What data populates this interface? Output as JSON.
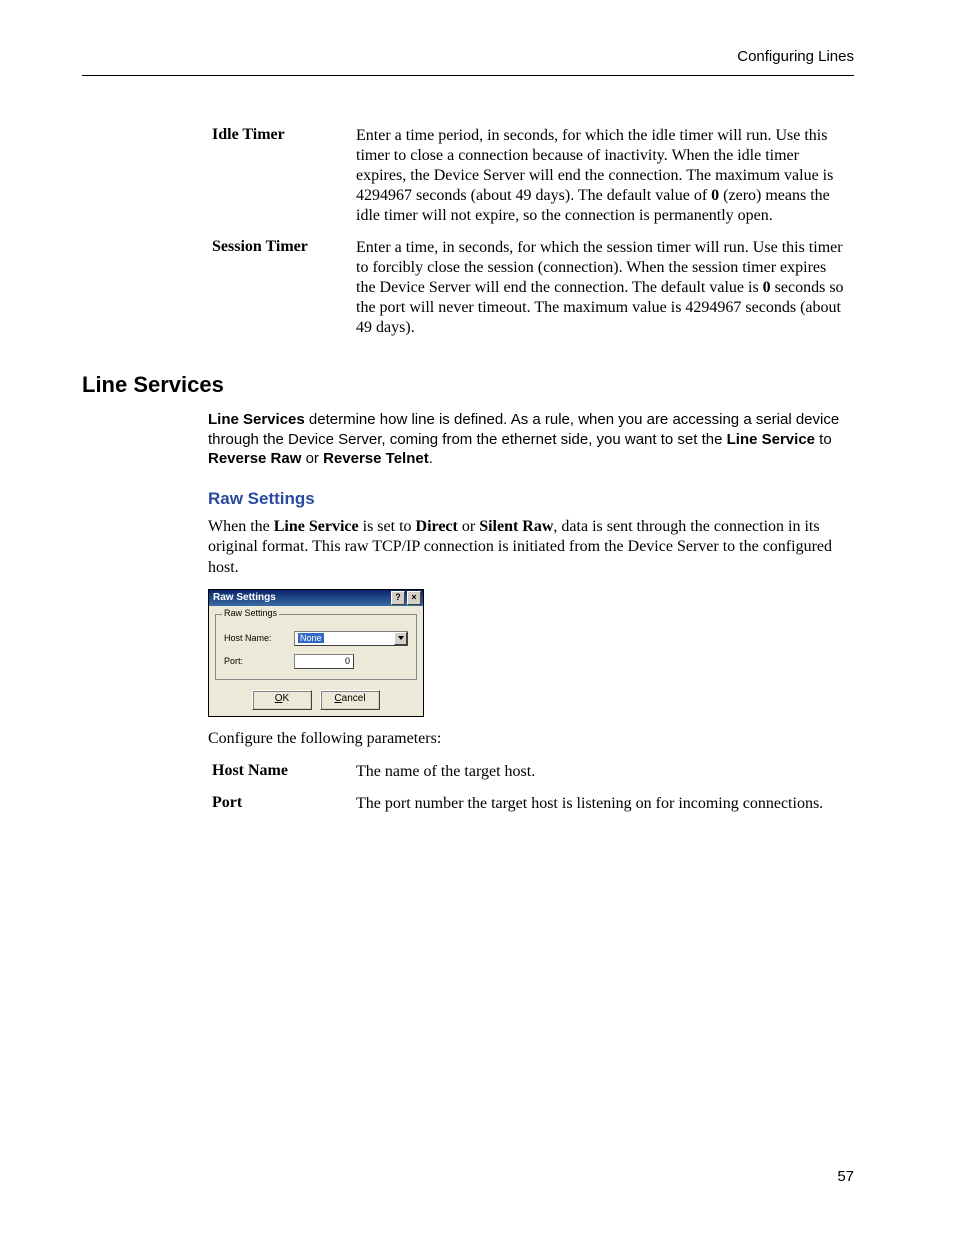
{
  "header": {
    "breadcrumb": "Configuring Lines"
  },
  "timer_defs": [
    {
      "label": "Idle Timer",
      "desc_parts": [
        "Enter a time period, in seconds, for which the idle timer will run. Use this timer to close a connection because of inactivity. When the idle timer expires, the Device Server will end the connection. The maximum value is 4294967 seconds (about 49 days). The default value of ",
        "0",
        " (zero) means the idle timer will not expire, so the connection is permanently open."
      ]
    },
    {
      "label": "Session Timer",
      "desc_parts": [
        "Enter a time, in seconds, for which the session timer will run. Use this timer to forcibly close the session (connection). When the session timer expires the Device Server will end the connection. The default value is ",
        "0",
        " seconds so the port will never timeout. The maximum value is 4294967 seconds (about 49 days)."
      ]
    }
  ],
  "line_services": {
    "heading": "Line Services",
    "para_parts": [
      "Line Services",
      " determine how line is defined. As a rule, when you are accessing a serial device through the Device Server, coming from the ethernet side, you want to set the ",
      "Line Service",
      " to ",
      "Reverse Raw",
      " or ",
      "Reverse Telnet",
      "."
    ]
  },
  "raw_settings": {
    "heading": "Raw Settings",
    "para_parts": [
      "When the ",
      "Line Service",
      " is set to ",
      "Direct",
      " or ",
      "Silent Raw",
      ", data is sent through the connection in its original format. This raw TCP/IP connection is initiated from the Device Server to the configured host."
    ],
    "dialog": {
      "title": "Raw Settings",
      "group_label": "Raw Settings",
      "host_label": "Host Name:",
      "host_value": "None",
      "port_label": "Port:",
      "port_value": "0",
      "ok_label": "OK",
      "cancel_label": "Cancel"
    },
    "configure_text": "Configure the following parameters:",
    "param_defs": [
      {
        "label": "Host Name",
        "desc": "The name of the target host."
      },
      {
        "label": "Port",
        "desc": "The port number the target host is listening on for incoming connections."
      }
    ]
  },
  "page_number": "57"
}
